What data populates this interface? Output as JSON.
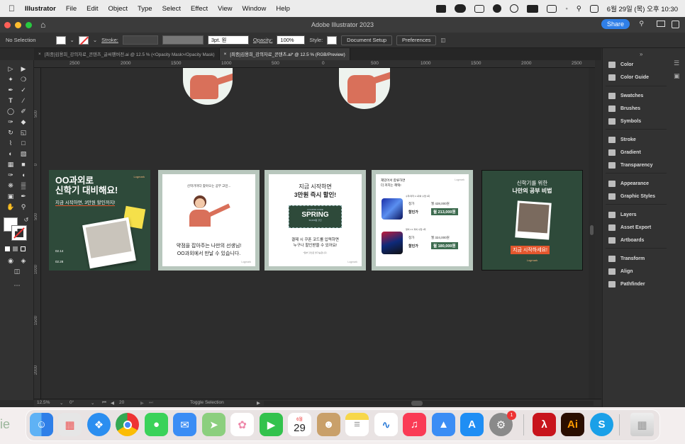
{
  "menubar": {
    "apple": "",
    "app": "Illustrator",
    "items": [
      "File",
      "Edit",
      "Object",
      "Type",
      "Select",
      "Effect",
      "View",
      "Window",
      "Help"
    ],
    "clock": "6월 29일 (목) 오후 10:30"
  },
  "window": {
    "title": "Adobe Illustrator 2023",
    "share": "Share"
  },
  "control": {
    "selection": "No Selection",
    "stroke_label": "Stroke:",
    "brush": "3pt. 원",
    "opacity_label": "Opacity:",
    "opacity": "100%",
    "style_label": "Style:",
    "doc_setup": "Document Setup",
    "preferences": "Preferences"
  },
  "tabs": [
    {
      "label": "[최종]김용희_강의자료_콘텐츠_글씨팬버전.ai @ 12.5 % (<Opacity Mask>/Opacity Mask)"
    },
    {
      "label": "[최종]김용희_강의자료_콘텐츠.ai* @ 12.5 % (RGB/Preview)"
    }
  ],
  "ruler": {
    "h": [
      "2500",
      "2000",
      "1500",
      "1000",
      "500",
      "0",
      "500",
      "1000",
      "1500",
      "2000",
      "2500"
    ],
    "v": [
      "500",
      "0",
      "500",
      "1000",
      "1500",
      "2000"
    ]
  },
  "artboards": {
    "a1": {
      "brand": "Logmark",
      "title1": "OO과외로",
      "title2": "신학기 대비해요!",
      "sub": "지금 시작하면, 3만원 할인까지!",
      "d1": "02.14",
      "d2": "02.28"
    },
    "a2": {
      "top": "신학기마다 찾아오는 공부 고민...",
      "l1": "약점을 잡아주는 나만의 선생님!",
      "l2": "OO과외에서 만날 수 있습니다.",
      "brand": "Logmark"
    },
    "a3": {
      "t1": "지금 시작하면",
      "t2": "3만원 즉시 할인!",
      "coupon_code": "COUPON CODE",
      "coupon": "SPRING",
      "coupon_sub": "30,000원 할인",
      "l1": "결제 시 쿠폰 코드를 입력하면",
      "l2": "누구나 할인받을 수 있어요!",
      "note": "*일부 할인은 불가능합니다.",
      "brand": "Logmark"
    },
    "a4": {
      "t1": "재밌어서 합류하면",
      "t2": "더 커지는 혜택!",
      "p1_head": "수학/과학 1:1과외 수업 1회",
      "p1_orig_label": "정가",
      "p1_orig": "월 428,000원",
      "p1_sale_label": "할인가",
      "p1_sale": "월 213,000원",
      "p2_head": "영어 1:1 과외 수업 1회",
      "p2_orig_label": "정가",
      "p2_orig": "월 324,000원",
      "p2_sale_label": "할인가",
      "p2_sale": "월 180,000원",
      "brand": "Logmark"
    },
    "a5": {
      "t1": "신학기를 위한",
      "t2": "나만의 공부 비법",
      "cta": "지금 시작하세요!",
      "brand": "Logmark"
    }
  },
  "panels": [
    "Color",
    "Color Guide",
    "Swatches",
    "Brushes",
    "Symbols",
    "Stroke",
    "Gradient",
    "Transparency",
    "Appearance",
    "Graphic Styles",
    "Layers",
    "Asset Export",
    "Artboards",
    "Transform",
    "Align",
    "Pathfinder"
  ],
  "status": {
    "zoom": "12.5%",
    "angle": "0°",
    "artboard": "20",
    "mode": "Toggle Selection"
  },
  "dock": {
    "calendar_month": "6월",
    "calendar_day": "29",
    "badge": "1",
    "apps": [
      "Finder",
      "Launchpad",
      "Safari",
      "Chrome",
      "Messages",
      "Mail",
      "Maps",
      "Photos",
      "FaceTime",
      "Calendar",
      "Contacts",
      "Notes",
      "Freeform",
      "Music",
      "Keynote",
      "App Store",
      "System Settings",
      "Acrobat",
      "Illustrator",
      "Skype",
      "Trash"
    ]
  },
  "colors": {
    "green": "#2e4a3a",
    "accent": "#e4572e",
    "sale": "#3d6b4f",
    "panel": "#323232"
  }
}
